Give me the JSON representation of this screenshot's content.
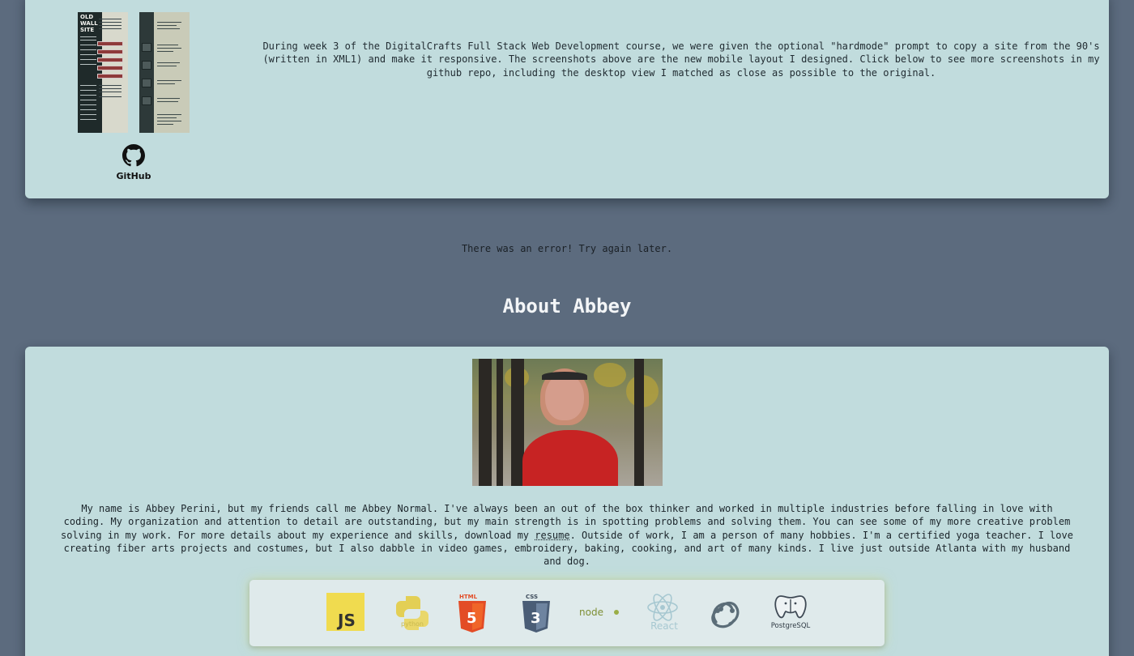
{
  "project": {
    "screenshot1_title": "OLD WALL SITE",
    "github_label": "GitHub",
    "description": "During week 3 of the DigitalCrafts Full Stack Web Development course, we were given the optional \"hardmode\" prompt to copy a site from the 90's (written in XML1) and make it responsive. The screenshots above are the new mobile layout I designed. Click below to see more screenshots in my github repo, including the desktop view I matched as close as possible to the original."
  },
  "error_message": "There was an error! Try again later.",
  "about": {
    "title": "About Abbey",
    "bio_before_link": "My name is Abbey Perini, but my friends call me Abbey Normal. I've always been an out of the box thinker and worked in multiple industries before falling in love with coding. My organization and attention to detail are outstanding, but my main strength is in spotting problems and solving them. You can see some of my more creative problem solving in my work. For more details about my experience and skills, download my ",
    "resume_link": "resume",
    "bio_after_link": ". Outside of work, I am a person of many hobbies. I'm a certified yoga teacher. I love creating fiber arts projects and costumes, but I also dabble in video games, embroidery, baking, cooking, and art of many kinds. I live just outside Atlanta with my husband and dog."
  },
  "skills": [
    {
      "name": "javascript-logo",
      "label": "JS",
      "color": "#f0db4f"
    },
    {
      "name": "python-logo",
      "label": "python",
      "color": "#e8d36a"
    },
    {
      "name": "html5-logo",
      "label": "HTML",
      "color": "#e34c26"
    },
    {
      "name": "css3-logo",
      "label": "CSS",
      "color": "#3c6fa5"
    },
    {
      "name": "nodejs-logo",
      "label": "node",
      "color": "#8a9a3a"
    },
    {
      "name": "react-logo",
      "label": "React",
      "color": "#a9c7cf"
    },
    {
      "name": "redux-logo",
      "label": "",
      "color": "#5b6d78"
    },
    {
      "name": "postgresql-logo",
      "label": "PostgreSQL",
      "color": "#3f4a55"
    }
  ]
}
